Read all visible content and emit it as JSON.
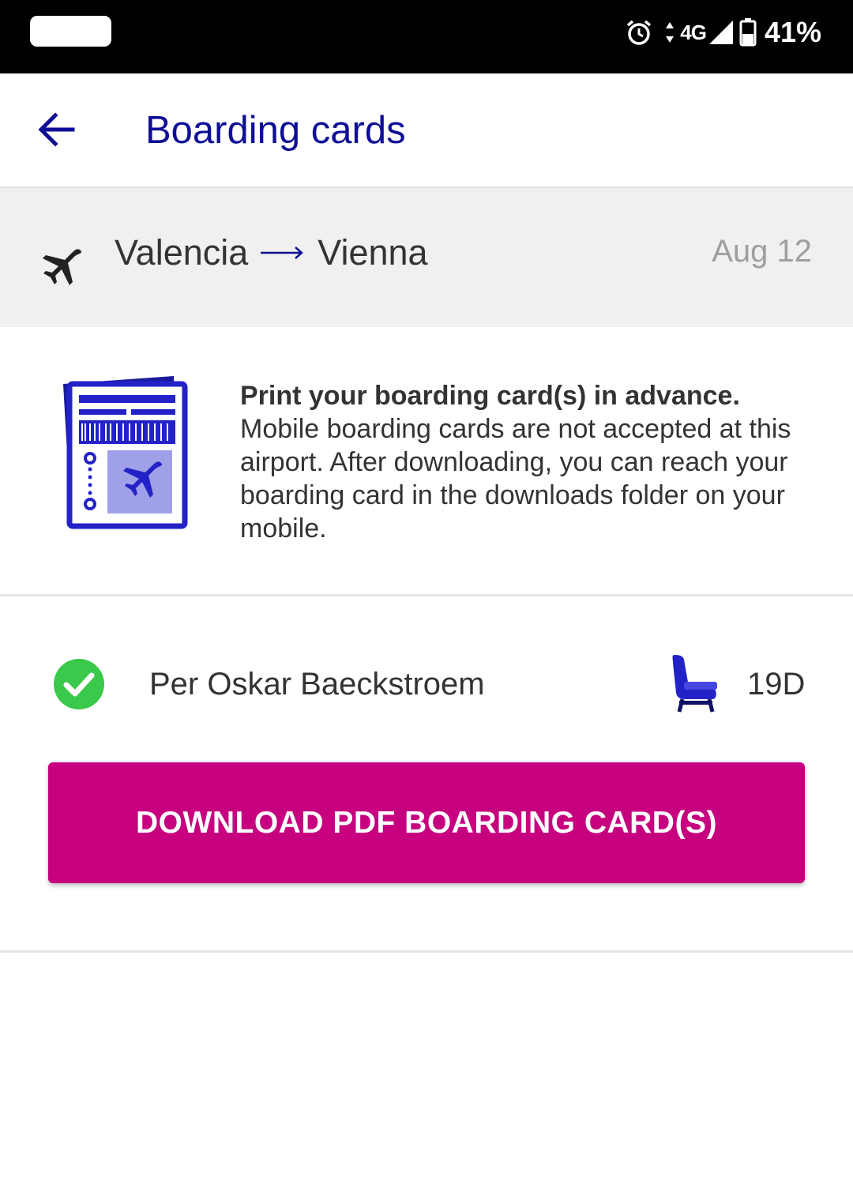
{
  "status_bar": {
    "network": "4G",
    "battery": "41%",
    "icons": [
      "alarm-icon",
      "data-arrows-icon",
      "signal-icon",
      "battery-icon"
    ]
  },
  "app_bar": {
    "title": "Boarding cards",
    "back_icon": "arrow-left-icon",
    "accent_color": "#0e0e96"
  },
  "flight": {
    "origin": "Valencia",
    "destination": "Vienna",
    "date": "Aug 12",
    "icon": "plane-icon"
  },
  "notice": {
    "heading": "Print your boarding card(s) in advance.",
    "body": "Mobile boarding cards are not accepted at this airport. After downloading, you can reach your boarding card in the downloads folder on your mobile.",
    "illustration": "boarding-pass-illustration"
  },
  "passengers": [
    {
      "name": "Per Oskar Baeckstroem",
      "seat": "19D",
      "status_icon": "check-circle-icon",
      "seat_icon": "seat-icon"
    }
  ],
  "actions": {
    "download_label": "DOWNLOAD PDF BOARDING CARD(S)",
    "button_color": "#c6007e"
  },
  "colors": {
    "check_green": "#3ac94a",
    "illustration_blue": "#2222c8"
  }
}
